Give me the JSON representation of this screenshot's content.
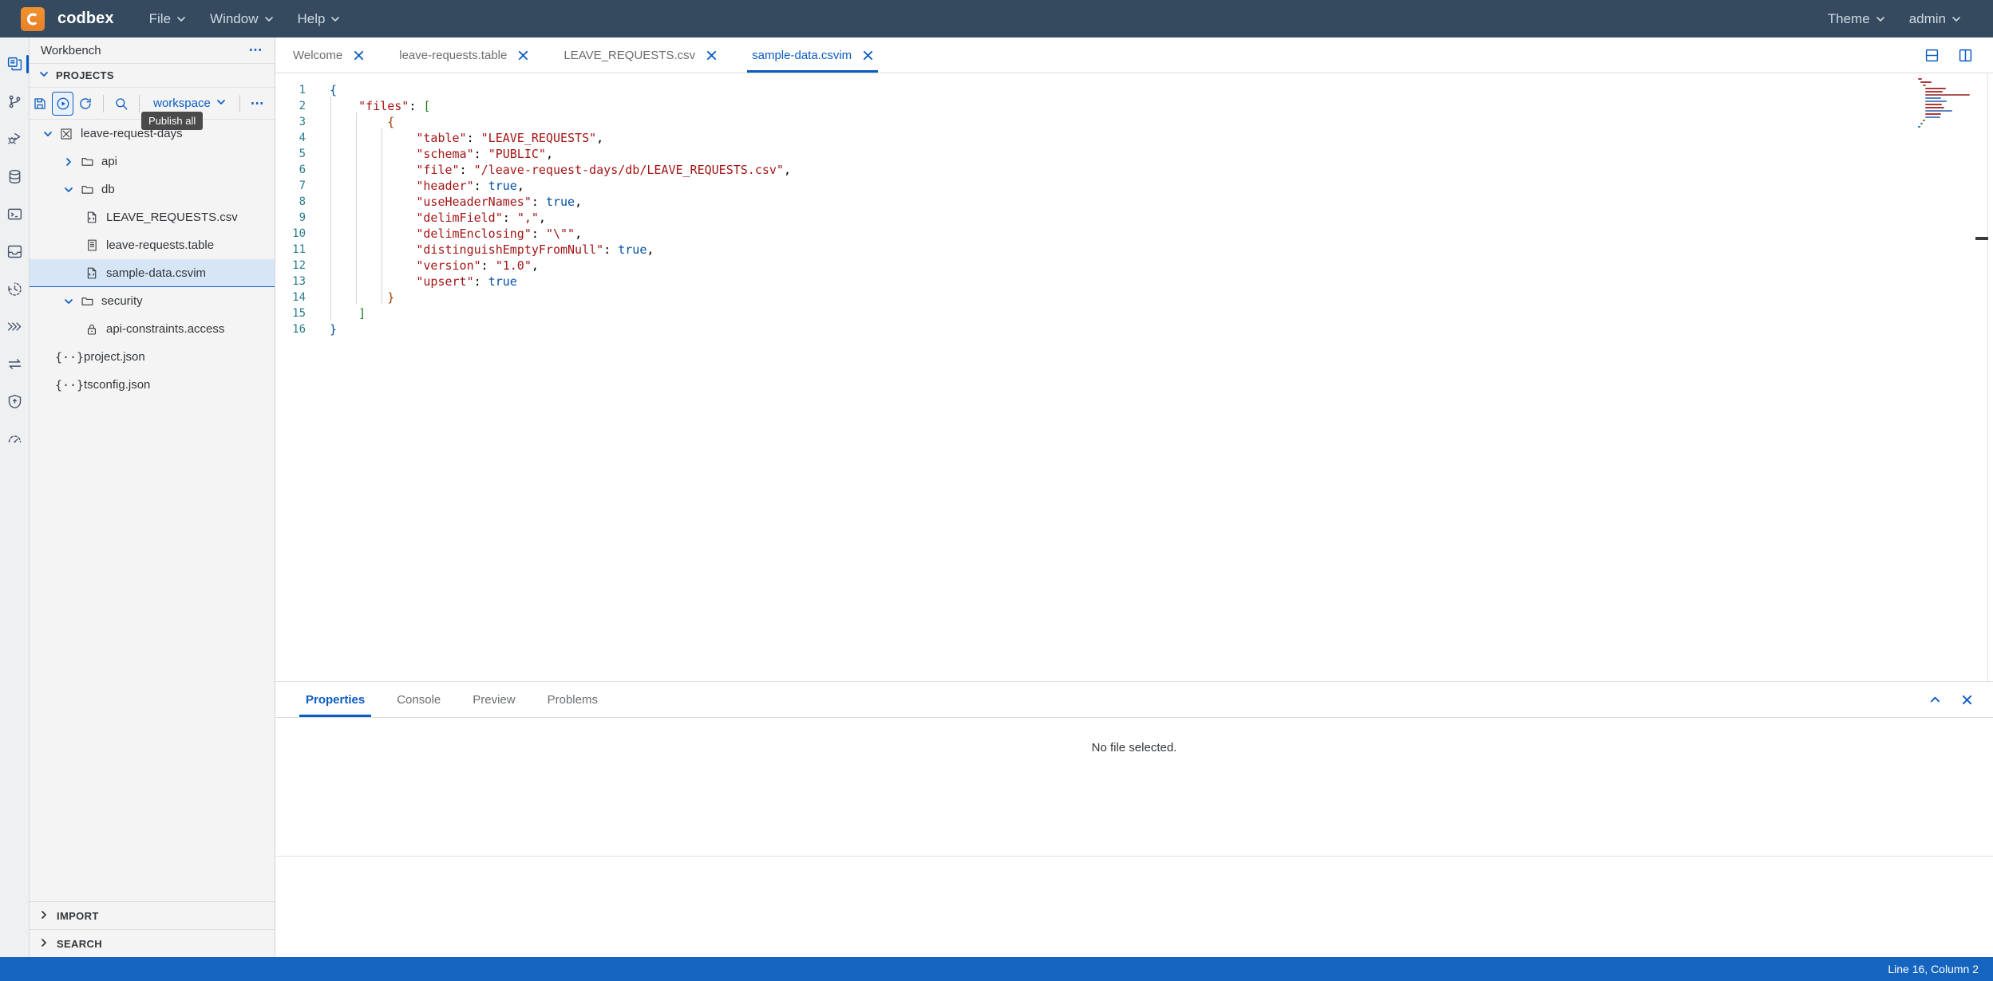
{
  "topbar": {
    "brand": "codbex",
    "logo_icon": "codbex-logo-icon",
    "menus": [
      {
        "label": "File",
        "icon": "chevron-down-icon"
      },
      {
        "label": "Window",
        "icon": "chevron-down-icon"
      },
      {
        "label": "Help",
        "icon": "chevron-down-icon"
      }
    ],
    "right_menus": [
      {
        "label": "Theme",
        "icon": "chevron-down-icon"
      },
      {
        "label": "admin",
        "icon": "chevron-down-icon"
      }
    ]
  },
  "rail": {
    "items": [
      {
        "name": "workbench-icon",
        "label": "Workbench",
        "active": true
      },
      {
        "name": "git-branch-icon",
        "label": "Git",
        "active": false
      },
      {
        "name": "debugger-icon",
        "label": "Debugger",
        "active": false
      },
      {
        "name": "database-icon",
        "label": "Database",
        "active": false
      },
      {
        "name": "terminal-icon",
        "label": "Terminal",
        "active": false
      },
      {
        "name": "inbox-icon",
        "label": "Inbox",
        "active": false
      },
      {
        "name": "history-icon",
        "label": "History",
        "active": false
      },
      {
        "name": "jobs-icon",
        "label": "Jobs",
        "active": false
      },
      {
        "name": "transfer-icon",
        "label": "Transfer",
        "active": false
      },
      {
        "name": "security-shield-icon",
        "label": "Security",
        "active": false
      },
      {
        "name": "monitoring-icon",
        "label": "Monitoring",
        "active": false
      }
    ]
  },
  "explorer": {
    "title": "Workbench",
    "more_icon": "ellipsis-icon",
    "section": {
      "label": "PROJECTS",
      "chevron": "chevron-down-icon"
    },
    "toolbar": {
      "save_all": {
        "name": "save-all-icon",
        "tooltip": "Save all"
      },
      "publish_all": {
        "name": "publish-all-icon",
        "tooltip": "Publish all"
      },
      "refresh": {
        "name": "refresh-icon",
        "tooltip": "Refresh"
      },
      "search": {
        "name": "search-icon",
        "tooltip": "Search"
      },
      "workspace_select": {
        "label": "workspace",
        "icon": "chevron-down-icon"
      },
      "more": {
        "name": "ellipsis-icon"
      }
    },
    "active_tooltip": "Publish all",
    "tree": [
      {
        "label": "leave-request-days",
        "indent": 0,
        "arrow": "chevron-down-icon",
        "icon": "project-icon",
        "selected": false
      },
      {
        "label": "api",
        "indent": 1,
        "arrow": "chevron-right-icon",
        "icon": "folder-icon",
        "selected": false
      },
      {
        "label": "db",
        "indent": 1,
        "arrow": "chevron-down-icon",
        "icon": "folder-icon",
        "selected": false
      },
      {
        "label": "LEAVE_REQUESTS.csv",
        "indent": 2,
        "arrow": "",
        "icon": "csv-file-icon",
        "selected": false
      },
      {
        "label": "leave-requests.table",
        "indent": 2,
        "arrow": "",
        "icon": "table-file-icon",
        "selected": false
      },
      {
        "label": "sample-data.csvim",
        "indent": 2,
        "arrow": "",
        "icon": "csv-file-icon",
        "selected": true
      },
      {
        "label": "security",
        "indent": 1,
        "arrow": "chevron-down-icon",
        "icon": "folder-icon",
        "selected": false
      },
      {
        "label": "api-constraints.access",
        "indent": 2,
        "arrow": "",
        "icon": "lock-file-icon",
        "selected": false
      },
      {
        "label": "project.json",
        "indent": 1,
        "arrow": "",
        "icon": "json-file-icon",
        "selected": false
      },
      {
        "label": "tsconfig.json",
        "indent": 1,
        "arrow": "",
        "icon": "json-file-icon",
        "selected": false
      }
    ],
    "footer_sections": [
      {
        "label": "IMPORT",
        "chevron": "chevron-right-icon"
      },
      {
        "label": "SEARCH",
        "chevron": "chevron-right-icon"
      }
    ]
  },
  "editor": {
    "tabs": [
      {
        "label": "Welcome",
        "active": false,
        "close_icon": "close-icon"
      },
      {
        "label": "leave-requests.table",
        "active": false,
        "close_icon": "close-icon"
      },
      {
        "label": "LEAVE_REQUESTS.csv",
        "active": false,
        "close_icon": "close-icon"
      },
      {
        "label": "sample-data.csvim",
        "active": true,
        "close_icon": "close-icon"
      }
    ],
    "actions": [
      {
        "name": "split-horizontal-icon"
      },
      {
        "name": "split-vertical-icon"
      }
    ],
    "line_count": 16,
    "lines": [
      {
        "n": 1,
        "tokens": [
          {
            "t": "{",
            "c": "brace"
          }
        ],
        "indent": 0
      },
      {
        "n": 2,
        "tokens": [
          {
            "t": "    ",
            "c": "punc"
          },
          {
            "t": "\"files\"",
            "c": "k"
          },
          {
            "t": ": ",
            "c": "punc"
          },
          {
            "t": "[",
            "c": "brkt"
          }
        ],
        "indent": 0
      },
      {
        "n": 3,
        "tokens": [
          {
            "t": "        ",
            "c": "punc"
          },
          {
            "t": "{",
            "c": "brace2"
          }
        ],
        "indent": 1
      },
      {
        "n": 4,
        "tokens": [
          {
            "t": "            ",
            "c": "punc"
          },
          {
            "t": "\"table\"",
            "c": "k"
          },
          {
            "t": ": ",
            "c": "punc"
          },
          {
            "t": "\"LEAVE_REQUESTS\"",
            "c": "s"
          },
          {
            "t": ",",
            "c": "punc"
          }
        ],
        "indent": 2
      },
      {
        "n": 5,
        "tokens": [
          {
            "t": "            ",
            "c": "punc"
          },
          {
            "t": "\"schema\"",
            "c": "k"
          },
          {
            "t": ": ",
            "c": "punc"
          },
          {
            "t": "\"PUBLIC\"",
            "c": "s"
          },
          {
            "t": ",",
            "c": "punc"
          }
        ],
        "indent": 2
      },
      {
        "n": 6,
        "tokens": [
          {
            "t": "            ",
            "c": "punc"
          },
          {
            "t": "\"file\"",
            "c": "k"
          },
          {
            "t": ": ",
            "c": "punc"
          },
          {
            "t": "\"/leave-request-days/db/LEAVE_REQUESTS.csv\"",
            "c": "s"
          },
          {
            "t": ",",
            "c": "punc"
          }
        ],
        "indent": 2
      },
      {
        "n": 7,
        "tokens": [
          {
            "t": "            ",
            "c": "punc"
          },
          {
            "t": "\"header\"",
            "c": "k"
          },
          {
            "t": ": ",
            "c": "punc"
          },
          {
            "t": "true",
            "c": "b"
          },
          {
            "t": ",",
            "c": "punc"
          }
        ],
        "indent": 2
      },
      {
        "n": 8,
        "tokens": [
          {
            "t": "            ",
            "c": "punc"
          },
          {
            "t": "\"useHeaderNames\"",
            "c": "k"
          },
          {
            "t": ": ",
            "c": "punc"
          },
          {
            "t": "true",
            "c": "b"
          },
          {
            "t": ",",
            "c": "punc"
          }
        ],
        "indent": 2
      },
      {
        "n": 9,
        "tokens": [
          {
            "t": "            ",
            "c": "punc"
          },
          {
            "t": "\"delimField\"",
            "c": "k"
          },
          {
            "t": ": ",
            "c": "punc"
          },
          {
            "t": "\",\"",
            "c": "s"
          },
          {
            "t": ",",
            "c": "punc"
          }
        ],
        "indent": 2
      },
      {
        "n": 10,
        "tokens": [
          {
            "t": "            ",
            "c": "punc"
          },
          {
            "t": "\"delimEnclosing\"",
            "c": "k"
          },
          {
            "t": ": ",
            "c": "punc"
          },
          {
            "t": "\"\\\"\"",
            "c": "s"
          },
          {
            "t": ",",
            "c": "punc"
          }
        ],
        "indent": 2
      },
      {
        "n": 11,
        "tokens": [
          {
            "t": "            ",
            "c": "punc"
          },
          {
            "t": "\"distinguishEmptyFromNull\"",
            "c": "k"
          },
          {
            "t": ": ",
            "c": "punc"
          },
          {
            "t": "true",
            "c": "b"
          },
          {
            "t": ",",
            "c": "punc"
          }
        ],
        "indent": 2
      },
      {
        "n": 12,
        "tokens": [
          {
            "t": "            ",
            "c": "punc"
          },
          {
            "t": "\"version\"",
            "c": "k"
          },
          {
            "t": ": ",
            "c": "punc"
          },
          {
            "t": "\"1.0\"",
            "c": "s"
          },
          {
            "t": ",",
            "c": "punc"
          }
        ],
        "indent": 2
      },
      {
        "n": 13,
        "tokens": [
          {
            "t": "            ",
            "c": "punc"
          },
          {
            "t": "\"upsert\"",
            "c": "k"
          },
          {
            "t": ": ",
            "c": "punc"
          },
          {
            "t": "true",
            "c": "b"
          }
        ],
        "indent": 2
      },
      {
        "n": 14,
        "tokens": [
          {
            "t": "        ",
            "c": "punc"
          },
          {
            "t": "}",
            "c": "brace2"
          }
        ],
        "indent": 1
      },
      {
        "n": 15,
        "tokens": [
          {
            "t": "    ",
            "c": "punc"
          },
          {
            "t": "]",
            "c": "brkt"
          }
        ],
        "indent": 0
      },
      {
        "n": 16,
        "tokens": [
          {
            "t": "}",
            "c": "brace"
          }
        ],
        "indent": 0
      }
    ]
  },
  "bottom_panel": {
    "tabs": [
      {
        "label": "Properties",
        "active": true
      },
      {
        "label": "Console",
        "active": false
      },
      {
        "label": "Preview",
        "active": false
      },
      {
        "label": "Problems",
        "active": false
      }
    ],
    "actions": [
      {
        "name": "collapse-chevron-up-icon"
      },
      {
        "name": "close-icon"
      }
    ],
    "message": "No file selected."
  },
  "statusbar": {
    "position": "Line 16, Column 2"
  },
  "colors": {
    "topbar_bg": "#354a5f",
    "accent": "#0a5bc4",
    "status_bg": "#1565c0",
    "brand_orange": "#ea8c2b",
    "selection_bg": "#d6e6f7",
    "panel_bg": "#f4f4f4"
  }
}
